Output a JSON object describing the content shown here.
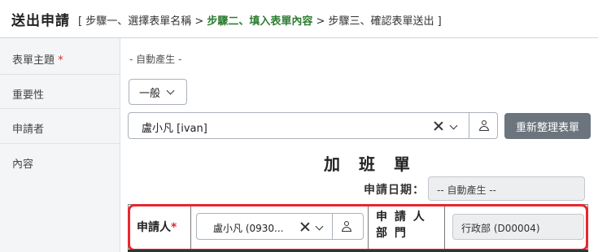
{
  "header": {
    "title": "送出申請",
    "steps_open": "[ 步驟一、選擇表單名稱 > ",
    "step_active": "步驟二、填入表單內容",
    "steps_close": " > 步驟三、確認表單送出 ]"
  },
  "fields": {
    "subject_label": "表單主題",
    "subject_required": "*",
    "subject_value": "- 自動產生 -",
    "importance_label": "重要性",
    "importance_value": "一般",
    "applicant_label": "申請者",
    "applicant_value": "盧小凡 [ivan]",
    "content_label": "內容",
    "rebuild_button": "重新整理表單"
  },
  "form": {
    "title": "加 班 單",
    "date_label": "申請日期：",
    "date_value": "-- 自動產生 --",
    "applicant_label": "申請人",
    "applicant_required": "*",
    "applicant_value": "盧小凡 (0930...",
    "dept_label": "申 請 人 部 門",
    "dept_value": "行政部 (D00004)"
  },
  "icons": {
    "clear": "close-icon",
    "dropdown": "chevron-down-icon",
    "user": "user-icon"
  },
  "colors": {
    "highlight": "#e8262f",
    "active_step": "#2e7d32",
    "button": "#6c757d"
  }
}
